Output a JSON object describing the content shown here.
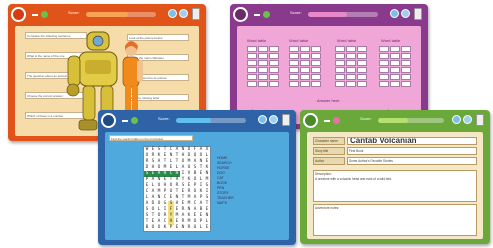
{
  "screens": {
    "orange": {
      "progress_label": "Score:",
      "progress": 0.6,
      "color": "#e0541a",
      "paper_color": "#f6dca8",
      "buttons": [
        "brain-button",
        "globe-button",
        "trash"
      ],
      "boxes": [
        "Complete the following sentence",
        "What is the name of the one",
        "The question about an animal",
        "Choose the correct answer",
        "Which of these is a number",
        "Look at the picture below",
        "Who is the main character",
        "Match the word to its picture",
        "Fill in the missing letter",
        "Select the right option"
      ]
    },
    "pink": {
      "progress_label": "Score:",
      "progress": 0.55,
      "color": "#8a3a8c",
      "paper_color": "#f0a7d8",
      "table_headers": [
        "Word table",
        "Word table",
        "Word table",
        "Word table"
      ],
      "footer_left": "Answer here",
      "footer_mid": "Answer here",
      "footer_right": "Answer"
    },
    "blue": {
      "progress_label": "Score:",
      "progress": 0.5,
      "color": "#2f63a8",
      "paper_color": "#4fa9dc",
      "instruction": "Find the words hidden in the grid below",
      "letters": [
        "WESTCANDFAX",
        "ORKENTHDQOL",
        "RSATLTOMANE",
        "DHOMELAUSTK",
        "SEARCHIVBEN",
        "PANETRYKOLM",
        "ELUHORSEPIG",
        "CAMPUTEROKI",
        "LANCENTMAPS",
        "ADOGSHEMCAT",
        "SOLIFERNABE",
        "STORYMAKEEN",
        "TEACHERMOPL",
        "BOOKPENRULE"
      ],
      "word_list": [
        "HOME",
        "SEARCH",
        "HORSE",
        "DOG",
        "CAT",
        "BOOK",
        "PEN",
        "STORY",
        "TEACHER",
        "MAPS"
      ]
    },
    "green": {
      "progress_label": "Score:",
      "progress": 0.45,
      "color": "#6aa83a",
      "paper_color": "#f4e8c6",
      "fields": [
        {
          "label": "Character name",
          "value": "Cantab Volcanian"
        },
        {
          "label": "Story title",
          "value": "First Book"
        },
        {
          "label": "Author",
          "value": "Some Author's Favorite Stories"
        }
      ],
      "area1_label": "Description:",
      "area1_text": "A creature with a volcanic head and ears of a wild bird.",
      "area2_label": "Adventure notes:"
    }
  }
}
